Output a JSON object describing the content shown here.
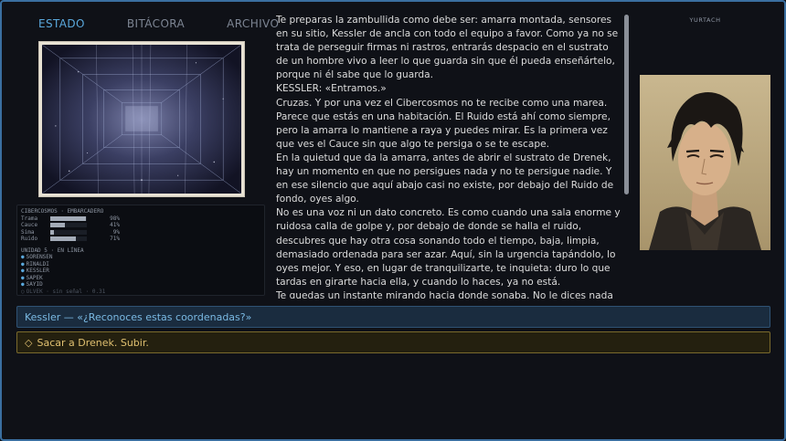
{
  "tabs": [
    {
      "label": "ESTADO",
      "active": true
    },
    {
      "label": "BITÁCORA",
      "active": false
    },
    {
      "label": "ARCHIVO",
      "active": false
    }
  ],
  "status": {
    "location": "CIBERCOSMOS · EMBARCADERO",
    "stats": [
      {
        "name": "Trama",
        "value": "98%",
        "level": 0.98
      },
      {
        "name": "Cauce",
        "value": "41%",
        "level": 0.41
      },
      {
        "name": "Sima",
        "value": "9%",
        "level": 0.09
      },
      {
        "name": "Ruido",
        "value": "71%",
        "level": 0.71
      }
    ],
    "unit_title": "UNIDAD 5 · EN LÍNEA",
    "units": [
      {
        "label": "SORENSEN",
        "online": true
      },
      {
        "label": "RINALDI",
        "online": true
      },
      {
        "label": "KESSLER",
        "online": true
      },
      {
        "label": "SAPEK",
        "online": true
      },
      {
        "label": "SAYID",
        "online": true
      },
      {
        "label": "OLVEK · sin señal · 0.31",
        "online": false
      }
    ]
  },
  "narrative": [
    "Te preparas la zambullida como debe ser: amarra montada, sensores en su sitio, Kessler de ancla con todo el equipo a favor. Como ya no se trata de perseguir firmas ni rastros, entrarás despacio en el sustrato de un hombre vivo a leer lo que guarda sin que él pueda enseñártelo, porque ni él sabe que lo guarda.",
    "KESSLER: «Entramos.»",
    "Cruzas. Y por una vez el Cibercosmos no te recibe como una marea. Parece que estás en una habitación. El Ruido está ahí como siempre, pero la amarra lo mantiene a raya y puedes mirar. Es la primera vez que ves el Cauce sin que algo te persiga o se te escape.",
    "En la quietud que da la amarra, antes de abrir el sustrato de Drenek, hay un momento en que no persigues nada y no te persigue nadie. Y en ese silencio que aquí abajo casi no existe, por debajo del Ruido de fondo, oyes algo.",
    "No es una voz ni un dato concreto. Es como cuando una sala enorme y ruidosa calla de golpe y, por debajo de donde se halla el ruido, descubres que hay otra cosa sonando todo el tiempo, baja, limpia, demasiado ordenada para ser azar. Aquí, sin la urgencia tapándolo, lo oyes mejor. Y eso, en lugar de tranquilizarte, te inquieta: duro lo que tardas en girarte hacia ella, y cuando lo haces, ya no está.",
    "Te quedas un instante mirando hacia donde sonaba. No le dices nada a Kessler. No sabrías qué decirle."
  ],
  "character": {
    "name": "YURTACH"
  },
  "choices": [
    {
      "label": "Kessler — «¿Reconoces estas coordenadas?»"
    },
    {
      "label": "Sacar a Drenek. Subir.",
      "marker": "◇"
    }
  ],
  "colors": {
    "accent": "#5aa8dc",
    "border": "#3a6fa0",
    "choice_gold": "#e0c070"
  }
}
